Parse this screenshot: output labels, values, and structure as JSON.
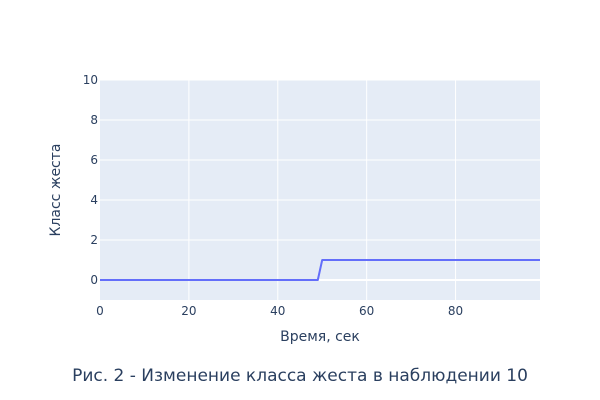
{
  "caption": "Рис. 2 - Изменение класса жеста в наблюдении 10",
  "chart_data": {
    "type": "line",
    "title": "",
    "xlabel": "Время, сек",
    "ylabel": "Класс жеста",
    "xlim": [
      0,
      99
    ],
    "ylim": [
      -1,
      10
    ],
    "xticks": [
      0,
      20,
      40,
      60,
      80
    ],
    "yticks": [
      0,
      2,
      4,
      6,
      8,
      10
    ],
    "grid": true,
    "legend": "none",
    "colors": {
      "plot_bg": "#e5ecf6",
      "grid": "#ffffff",
      "line": "#636efa",
      "text": "#2a3f5f"
    },
    "series": [
      {
        "x": [
          0,
          49,
          50,
          99
        ],
        "y": [
          0,
          0,
          1,
          1
        ]
      }
    ]
  }
}
